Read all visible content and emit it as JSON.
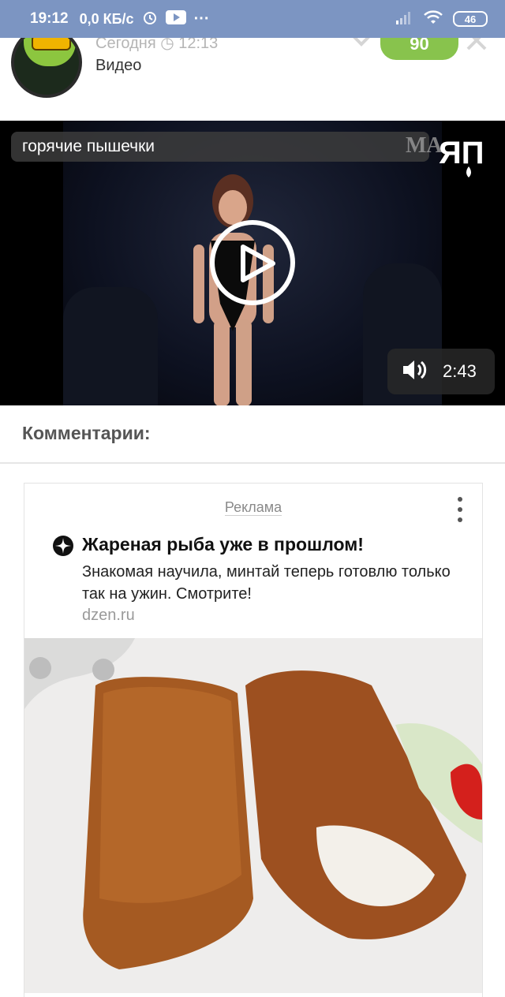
{
  "status_bar": {
    "time": "19:12",
    "network_speed": "0,0 КБ/с",
    "more": "···",
    "battery": "46"
  },
  "post": {
    "date": "Сегодня ◷ 12:13",
    "type": "Видео",
    "score": "90"
  },
  "video": {
    "title": "горячие пышечки",
    "duration": "2:43",
    "logo_text": "МАЯП"
  },
  "comments": {
    "title": "Комментарии:"
  },
  "ad": {
    "label": "Реклама",
    "title": "Жареная рыба уже в прошлом!",
    "text": "Знакомая научила, минтай теперь готовлю только так на ужин. Смотрите!",
    "source": "dzen.ru"
  },
  "colors": {
    "status_bar": "#7c95c2",
    "score_badge": "#88c34d"
  }
}
